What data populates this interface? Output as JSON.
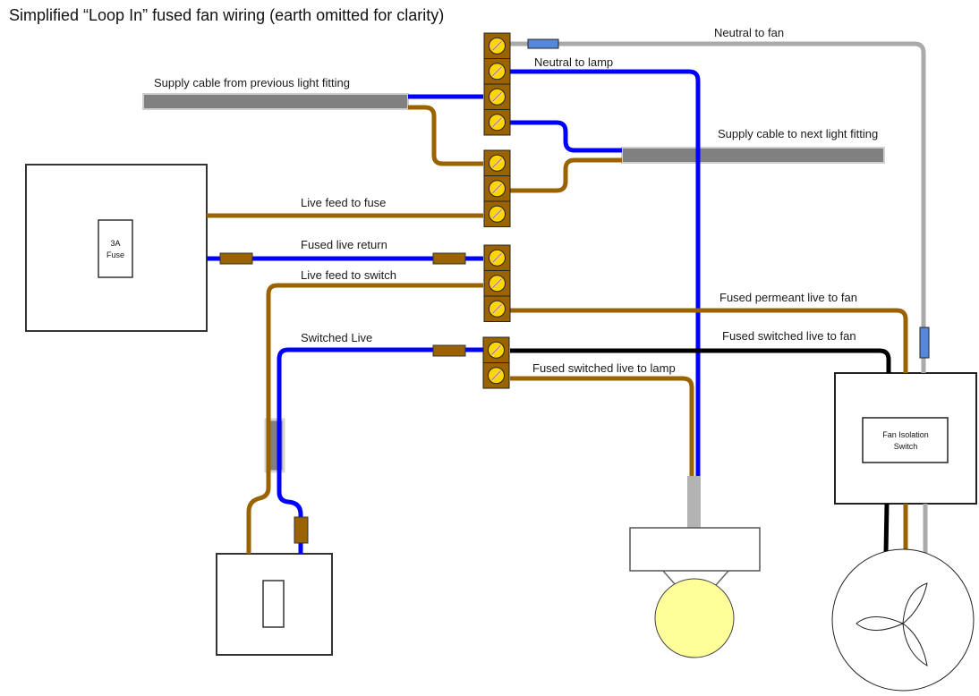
{
  "title": "Simplified “Loop In” fused fan wiring (earth omitted for clarity)",
  "colors": {
    "live": "#9a6300",
    "neutral": "#0000ff",
    "switched": "#000000",
    "fan_neutral": "#aaaaaa",
    "cable_sheath": "#808080",
    "terminal_body": "#9a6300",
    "screw": "#ffd700",
    "sleeve_blue": "#5588dd",
    "lamp_bulb": "#ffff99"
  },
  "labels": {
    "neutral_to_fan": "Neutral to fan",
    "neutral_to_lamp": "Neutral to lamp",
    "supply_from_previous": "Supply cable from previous light fitting",
    "supply_to_next": "Supply cable to next light fitting",
    "live_feed_to_fuse": "Live feed to fuse",
    "fused_live_return": "Fused live return",
    "live_feed_to_switch": "Live feed to switch",
    "fused_permanent_live_to_fan": "Fused permeant live to fan",
    "switched_live": "Switched Live",
    "fused_switched_live_to_fan": "Fused switched live to fan",
    "fused_switched_live_to_lamp": "Fused switched live to lamp"
  },
  "components": {
    "fused_spur": {
      "label_line1": "3A",
      "label_line2": "Fuse"
    },
    "fan_isolation_switch": {
      "label_line1": "Fan Isolation",
      "label_line2": "Switch"
    },
    "light_switch": {},
    "lamp": {},
    "fan": {}
  },
  "terminal_blocks": [
    {
      "name": "neutral-block",
      "terminals": 4
    },
    {
      "name": "live-block",
      "terminals": 3
    },
    {
      "name": "fused-live-block",
      "terminals": 3
    },
    {
      "name": "switched-live-block",
      "terminals": 2
    }
  ]
}
